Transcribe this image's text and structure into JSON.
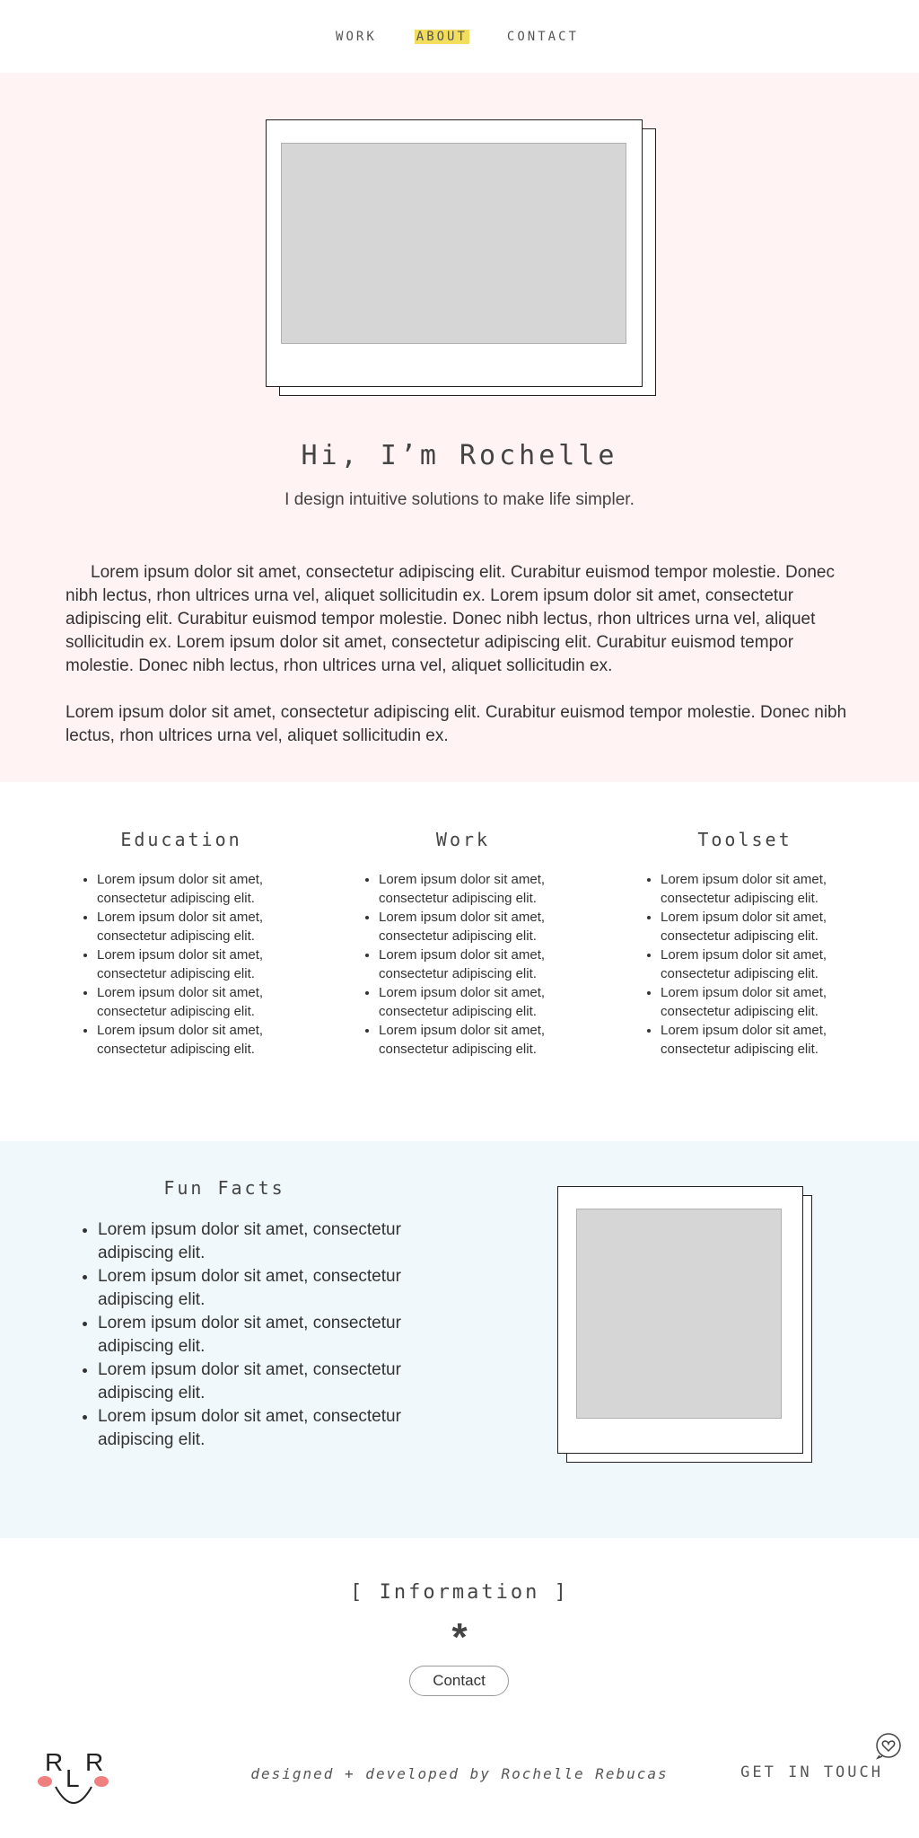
{
  "nav": {
    "items": [
      {
        "label": "WORK",
        "active": false
      },
      {
        "label": "ABOUT",
        "active": true
      },
      {
        "label": "CONTACT",
        "active": false
      }
    ]
  },
  "hero": {
    "title": "Hi, I’m Rochelle",
    "subtitle": "I design intuitive solutions to make life simpler.",
    "paragraphs": [
      "Lorem ipsum dolor sit amet, consectetur adipiscing elit. Curabitur euismod tempor molestie. Donec nibh lectus, rhon ultrices urna vel, aliquet sollicitudin ex. Lorem ipsum dolor sit amet, consectetur adipiscing elit. Curabitur euismod tempor molestie. Donec nibh lectus, rhon ultrices urna vel, aliquet sollicitudin ex. Lorem ipsum dolor sit amet, consectetur adipiscing elit. Curabitur euismod tempor molestie. Donec nibh lectus, rhon ultrices urna vel, aliquet sollicitudin ex.",
      "Lorem ipsum dolor sit amet, consectetur adipiscing elit. Curabitur euismod tempor molestie. Donec nibh lectus, rhon ultrices urna vel, aliquet sollicitudin ex."
    ]
  },
  "columns": [
    {
      "title": "Education",
      "items": [
        "Lorem ipsum dolor sit amet, consectetur adipiscing elit.",
        "Lorem ipsum dolor sit amet, consectetur adipiscing elit.",
        "Lorem ipsum dolor sit amet, consectetur adipiscing elit.",
        "Lorem ipsum dolor sit amet, consectetur adipiscing elit.",
        "Lorem ipsum dolor sit amet, consectetur adipiscing elit."
      ]
    },
    {
      "title": "Work",
      "items": [
        "Lorem ipsum dolor sit amet, consectetur adipiscing elit.",
        "Lorem ipsum dolor sit amet, consectetur adipiscing elit.",
        "Lorem ipsum dolor sit amet, consectetur adipiscing elit.",
        "Lorem ipsum dolor sit amet, consectetur adipiscing elit.",
        "Lorem ipsum dolor sit amet, consectetur adipiscing elit."
      ]
    },
    {
      "title": "Toolset",
      "items": [
        "Lorem ipsum dolor sit amet, consectetur adipiscing elit.",
        "Lorem ipsum dolor sit amet, consectetur adipiscing elit.",
        "Lorem ipsum dolor sit amet, consectetur adipiscing elit.",
        "Lorem ipsum dolor sit amet, consectetur adipiscing elit.",
        "Lorem ipsum dolor sit amet, consectetur adipiscing elit."
      ]
    }
  ],
  "fun_facts": {
    "title": "Fun Facts",
    "items": [
      "Lorem ipsum dolor sit amet, consectetur adipiscing elit.",
      "Lorem ipsum dolor sit amet, consectetur adipiscing elit.",
      "Lorem ipsum dolor sit amet, consectetur adipiscing elit.",
      "Lorem ipsum dolor sit amet, consectetur adipiscing elit.",
      "Lorem ipsum dolor sit amet, consectetur adipiscing elit."
    ]
  },
  "info": {
    "title": "[ Information ]",
    "asterisk": "*",
    "contact_label": "Contact"
  },
  "footer": {
    "logo_letters": [
      "R",
      "L",
      "R"
    ],
    "credit": "designed + developed by Rochelle Rebucas",
    "get_in_touch": "GET IN TOUCH"
  },
  "colors": {
    "hero_bg": "#fff3f3",
    "facts_bg": "#f0f8fb",
    "nav_highlight": "#f2de5c",
    "logo_cheeks": "#f08080",
    "placeholder": "#d6d6d6"
  },
  "icons": {
    "footer": "heart-chat-icon"
  }
}
